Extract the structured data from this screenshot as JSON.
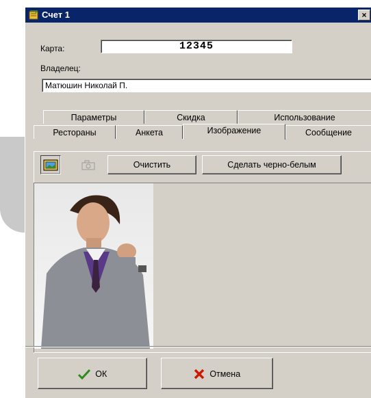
{
  "window": {
    "title": "Счет 1",
    "close_glyph": "×"
  },
  "form": {
    "card_label": "Карта:",
    "card_value": "12345",
    "owner_label": "Владелец:",
    "owner_value": "Матюшин Николай П."
  },
  "tabs_row1": [
    "Параметры",
    "Скидка",
    "Использование"
  ],
  "tabs_row2": [
    "Рестораны",
    "Анкета",
    "Изображение",
    "Сообщение"
  ],
  "active_tab": "Изображение",
  "toolbar": {
    "open_icon": "folder-open-icon",
    "camera_icon": "camera-icon",
    "clear_label": "Очистить",
    "bw_label": "Сделать черно-белым"
  },
  "footer": {
    "ok_label": "ОК",
    "cancel_label": "Отмена"
  },
  "colors": {
    "titlebar": "#0a246a",
    "face": "#d4d0c8",
    "ok_check": "#2e8b1c",
    "cancel_x": "#cc1a00"
  }
}
